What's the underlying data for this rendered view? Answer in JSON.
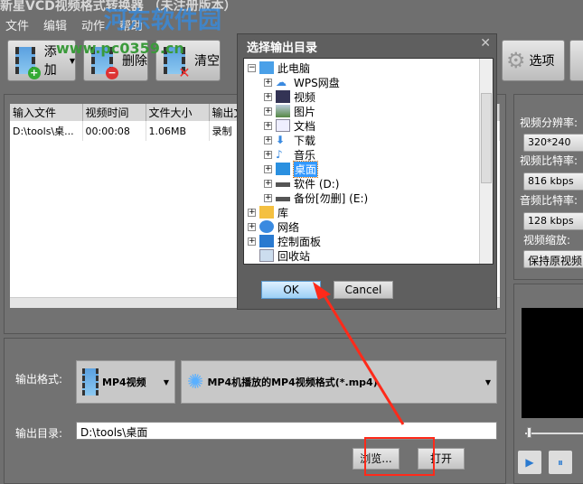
{
  "app": {
    "title": "新星VCD视频格式转换器 （未注册版本）",
    "watermark": "河东软件园",
    "watermark_url": "www.pc0359.cn"
  },
  "menu": [
    "文件",
    "编辑",
    "动作",
    "帮助"
  ],
  "toolbar": {
    "add": "添加",
    "delete": "删除",
    "clear": "清空",
    "options": "选项"
  },
  "table": {
    "headers": [
      "输入文件",
      "视频时间",
      "文件大小",
      "输出文"
    ],
    "rows": [
      [
        "D:\\tools\\桌...",
        "00:00:08",
        "1.06MB",
        "录制"
      ]
    ]
  },
  "settings": {
    "resolution_label": "视频分辨率:",
    "resolution": "320*240",
    "vbitrate_label": "视频比特率:",
    "vbitrate": "816 kbps",
    "abitrate_label": "音频比特率:",
    "abitrate": "128 kbps",
    "scale_label": "视频缩放:",
    "scale": "保持原视频"
  },
  "output": {
    "format_label": "输出格式:",
    "format": "MP4视频",
    "profile": "MP4机播放的MP4视频格式(*.mp4)",
    "dir_label": "输出目录:",
    "dir": "D:\\tools\\桌面",
    "browse": "浏览...",
    "open": "打开"
  },
  "dialog": {
    "title": "选择输出目录",
    "ok": "OK",
    "cancel": "Cancel",
    "tree": [
      "此电脑",
      "WPS网盘",
      "视频",
      "图片",
      "文档",
      "下载",
      "音乐",
      "桌面",
      "软件 (D:)",
      "备份[勿删] (E:)",
      "库",
      "网络",
      "控制面板",
      "回收站"
    ],
    "selected": "桌面"
  },
  "colors": {
    "accent": "#3399ff",
    "highlight": "#ff2a1a"
  }
}
